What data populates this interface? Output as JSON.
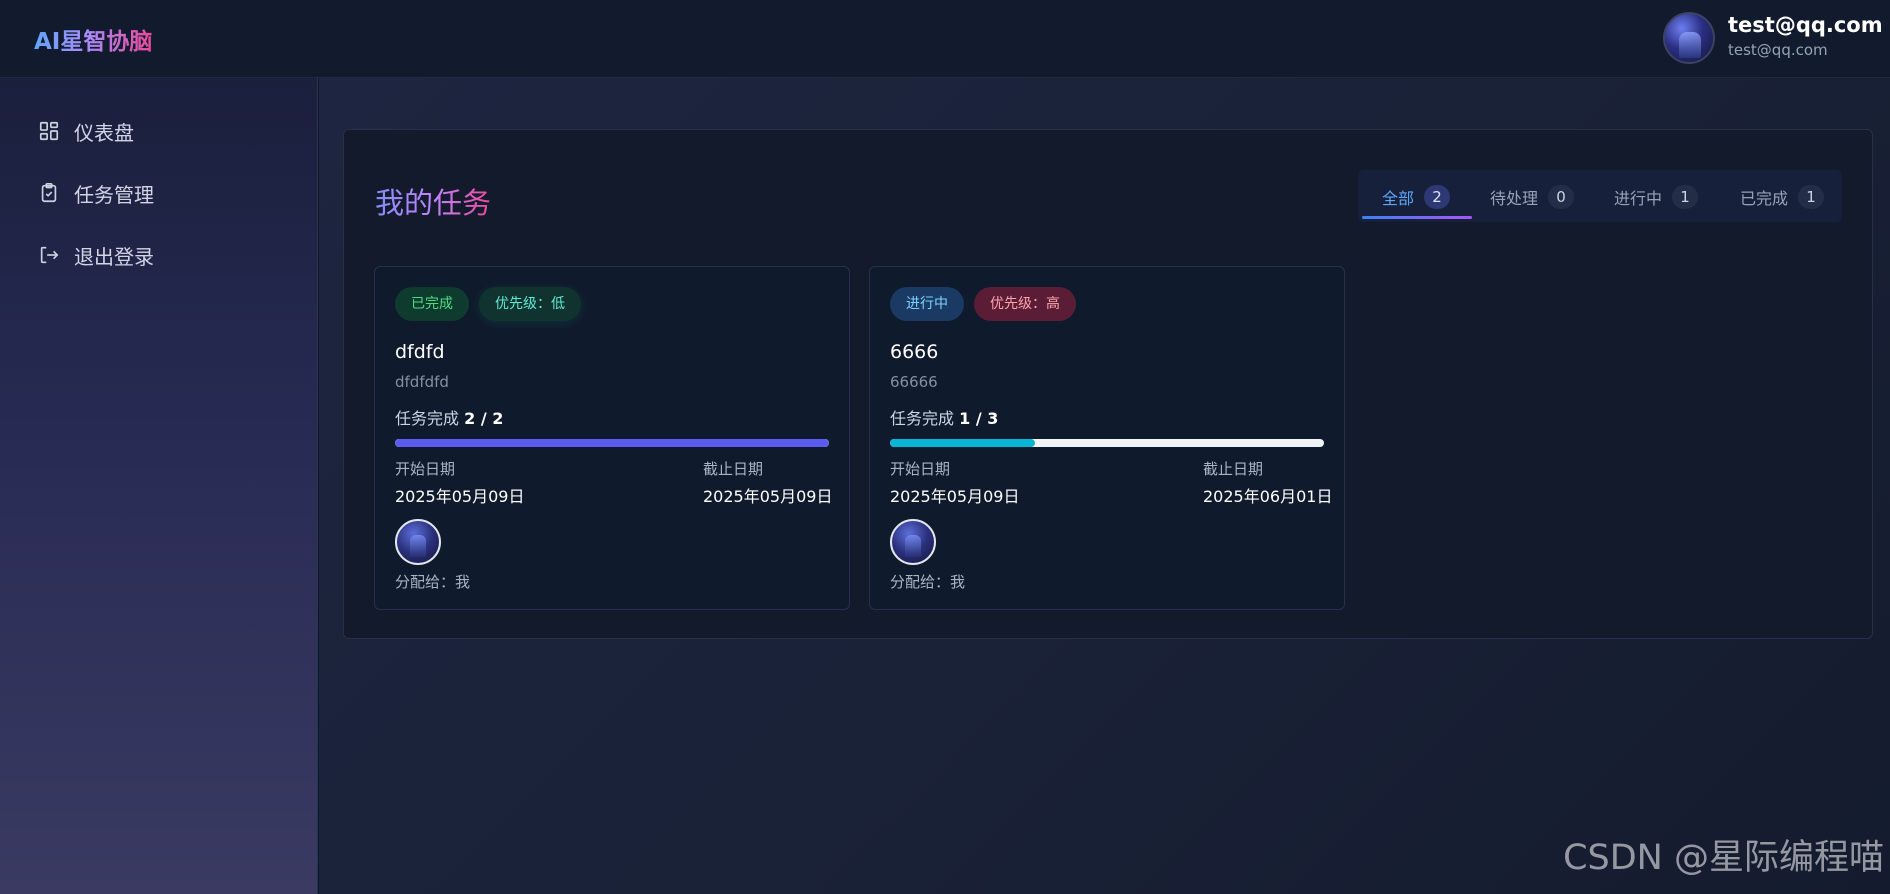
{
  "app": {
    "brand": "AI星智协脑"
  },
  "user": {
    "name": "test@qq.com",
    "email": "test@qq.com"
  },
  "sidebar": {
    "items": [
      {
        "label": "仪表盘",
        "icon": "dashboard-icon"
      },
      {
        "label": "任务管理",
        "icon": "clipboard-check-icon"
      },
      {
        "label": "退出登录",
        "icon": "logout-icon"
      }
    ]
  },
  "main": {
    "title": "我的任务",
    "tabs": [
      {
        "label": "全部",
        "count": "2",
        "active": true
      },
      {
        "label": "待处理",
        "count": "0"
      },
      {
        "label": "进行中",
        "count": "1"
      },
      {
        "label": "已完成",
        "count": "1"
      }
    ],
    "tasks": [
      {
        "status": "已完成",
        "priority": "优先级：低",
        "title": "dfdfd",
        "description": "dfdfdfd",
        "progress_prefix": "任务完成",
        "progress_value": "2 / 2",
        "progress_fraction": 1.0,
        "progress_color": "#5b5bf0",
        "start_label": "开始日期",
        "start_date": "2025年05月09日",
        "end_label": "截止日期",
        "end_date": "2025年05月09日",
        "assignee": "分配给：我"
      },
      {
        "status": "进行中",
        "priority": "优先级：高",
        "title": "6666",
        "description": "66666",
        "progress_prefix": "任务完成",
        "progress_value": "1 / 3",
        "progress_fraction": 0.333,
        "progress_color": "#06b6d4",
        "start_label": "开始日期",
        "start_date": "2025年05月09日",
        "end_label": "截止日期",
        "end_date": "2025年06月01日",
        "assignee": "分配给：我"
      }
    ]
  },
  "watermark": "CSDN @星际编程喵"
}
